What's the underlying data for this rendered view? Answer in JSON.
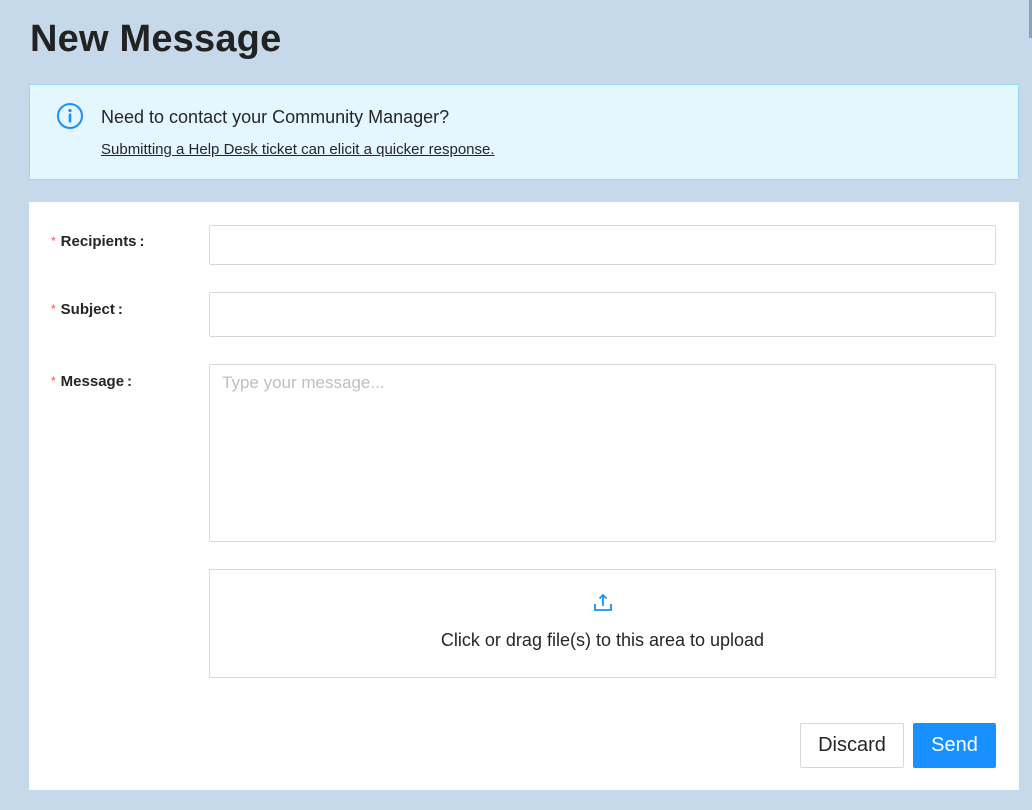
{
  "page": {
    "title": "New Message"
  },
  "alert": {
    "icon": "info-circle-icon",
    "title": "Need to contact your Community Manager?",
    "link_text": "Submitting a Help Desk ticket can elicit a quicker response."
  },
  "form": {
    "required_mark": "*",
    "colon": ":",
    "recipients": {
      "label": "Recipients",
      "value": ""
    },
    "subject": {
      "label": "Subject",
      "value": ""
    },
    "message": {
      "label": "Message",
      "placeholder": "Type your message...",
      "value": ""
    },
    "upload": {
      "icon": "upload-icon",
      "text": "Click or drag file(s) to this area to upload"
    }
  },
  "actions": {
    "discard_label": "Discard",
    "send_label": "Send"
  },
  "colors": {
    "background": "#c5d9ea",
    "alert_bg": "#e4f6fe",
    "alert_border": "#9fd6f3",
    "accent": "#1890ff",
    "required": "#ff4d4f"
  }
}
